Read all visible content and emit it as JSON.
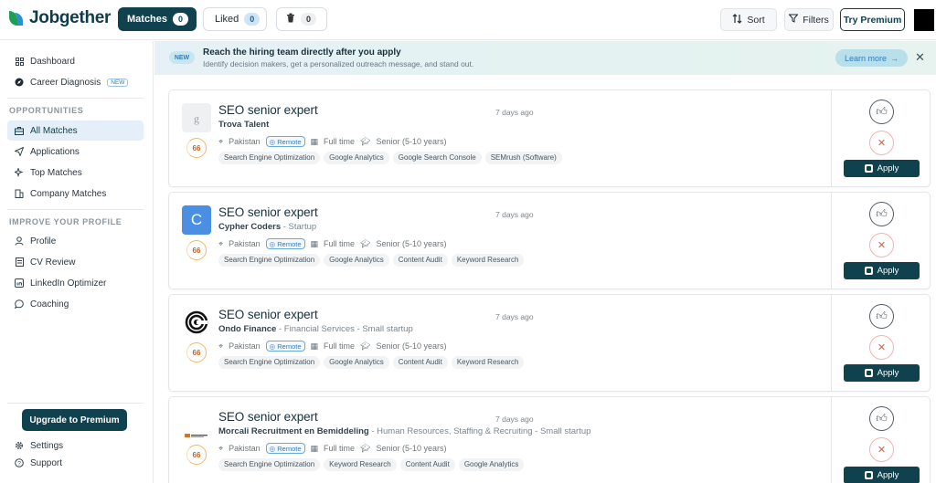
{
  "app": {
    "logo_text": "Jobgether",
    "brand_color": "#10414f"
  },
  "topbar": {
    "tabs": [
      {
        "label": "Matches",
        "count": "0"
      },
      {
        "label": "Liked",
        "count": "0"
      },
      {
        "label": "",
        "count": "0",
        "icon": "trash-icon"
      }
    ],
    "sort_label": "Sort",
    "filters_label": "Filters",
    "premium_label": "Try Premium"
  },
  "sidebar": {
    "dashboard": "Dashboard",
    "career_diagnosis": "Career Diagnosis",
    "career_badge": "NEW",
    "section_opportunities": "OPPORTUNITIES",
    "all_matches": "All Matches",
    "applications": "Applications",
    "top_matches": "Top Matches",
    "company_matches": "Company Matches",
    "section_profile": "IMPROVE YOUR PROFILE",
    "profile": "Profile",
    "cv_review": "CV Review",
    "linkedin_optimizer": "LinkedIn Optimizer",
    "coaching": "Coaching",
    "upgrade": "Upgrade to Premium",
    "settings": "Settings",
    "support": "Support"
  },
  "banner": {
    "badge": "NEW",
    "title": "Reach the hiring team directly after you apply",
    "subtitle": "Identify decision makers, get a personalized outreach message, and stand out.",
    "cta": "Learn more"
  },
  "jobs": [
    {
      "title": "SEO senior expert",
      "posted": "7 days ago",
      "company": "Trova Talent",
      "company_detail": "",
      "score": "66",
      "location": "Pakistan",
      "remote": "Remote",
      "employment": "Full time",
      "seniority": "Senior (5-10 years)",
      "tags": [
        "Search Engine Optimization",
        "Google Analytics",
        "Google Search Console",
        "SEMrush (Software)"
      ],
      "apply": "Apply"
    },
    {
      "title": "SEO senior expert",
      "posted": "7 days ago",
      "company": "Cypher Coders",
      "company_detail": " - Startup",
      "logo_letter": "C",
      "score": "66",
      "location": "Pakistan",
      "remote": "Remote",
      "employment": "Full time",
      "seniority": "Senior (5-10 years)",
      "tags": [
        "Search Engine Optimization",
        "Google Analytics",
        "Content Audit",
        "Keyword Research"
      ],
      "apply": "Apply"
    },
    {
      "title": "SEO senior expert",
      "posted": "7 days ago",
      "company": "Ondo Finance",
      "company_detail": " - Financial Services - Small startup",
      "score": "66",
      "location": "Pakistan",
      "remote": "Remote",
      "employment": "Full time",
      "seniority": "Senior (5-10 years)",
      "tags": [
        "Search Engine Optimization",
        "Google Analytics",
        "Content Audit",
        "Keyword Research"
      ],
      "apply": "Apply"
    },
    {
      "title": "SEO senior expert",
      "posted": "7 days ago",
      "company": "Morcali Recruitment en Bemiddeling",
      "company_detail": " - Human Resources, Staffing & Recruiting - Small startup",
      "score": "66",
      "location": "Pakistan",
      "remote": "Remote",
      "employment": "Full time",
      "seniority": "Senior (5-10 years)",
      "tags": [
        "Search Engine Optimization",
        "Keyword Research",
        "Content Audit",
        "Google Analytics"
      ],
      "apply": "Apply"
    }
  ]
}
